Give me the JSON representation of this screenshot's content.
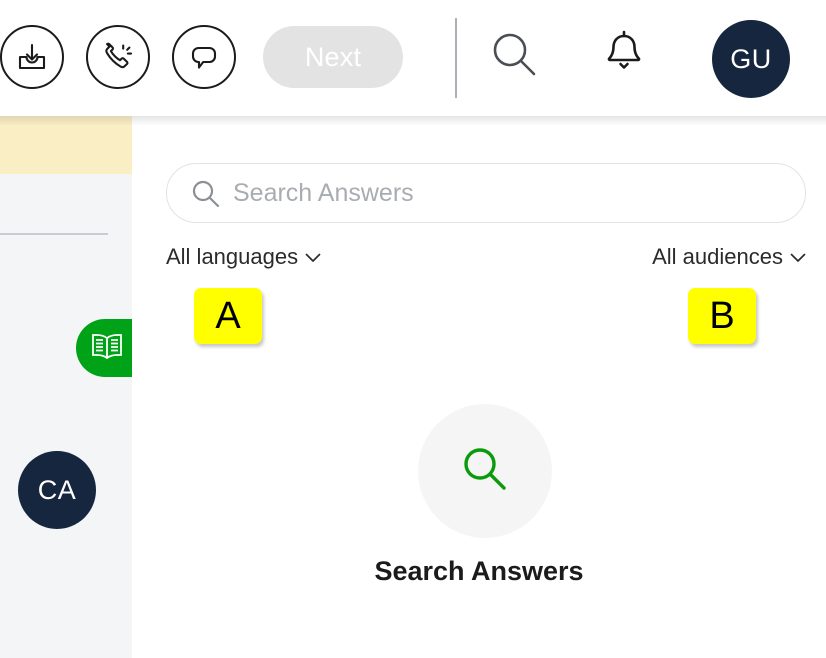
{
  "header": {
    "tools": [
      {
        "name": "download-inbox-icon",
        "label": "Download"
      },
      {
        "name": "phone-ringing-icon",
        "label": "Call"
      },
      {
        "name": "chat-bubble-icon",
        "label": "Chat"
      }
    ],
    "next_label": "Next",
    "search_icon": "search-icon",
    "bell_icon": "bell-icon",
    "avatar_initials": "GU"
  },
  "sidebar": {
    "book_icon": "book-icon",
    "avatar_initials": "CA"
  },
  "main": {
    "search": {
      "placeholder": "Search Answers",
      "value": "",
      "icon": "search-icon"
    },
    "filters": [
      {
        "label": "All languages",
        "icon": "chevron-down-icon"
      },
      {
        "label": "All audiences",
        "icon": "chevron-down-icon"
      }
    ],
    "empty_state": {
      "icon": "search-icon",
      "title": "Search Answers"
    }
  },
  "annotations": [
    {
      "letter": "A"
    },
    {
      "letter": "B"
    }
  ],
  "colors": {
    "accent_green": "#00a317",
    "navy": "#16263f",
    "badge_yellow": "#ffff00",
    "banner_yellow": "#faeec4",
    "panel_grey": "#f4f5f6",
    "next_grey": "#e3e3e3"
  }
}
